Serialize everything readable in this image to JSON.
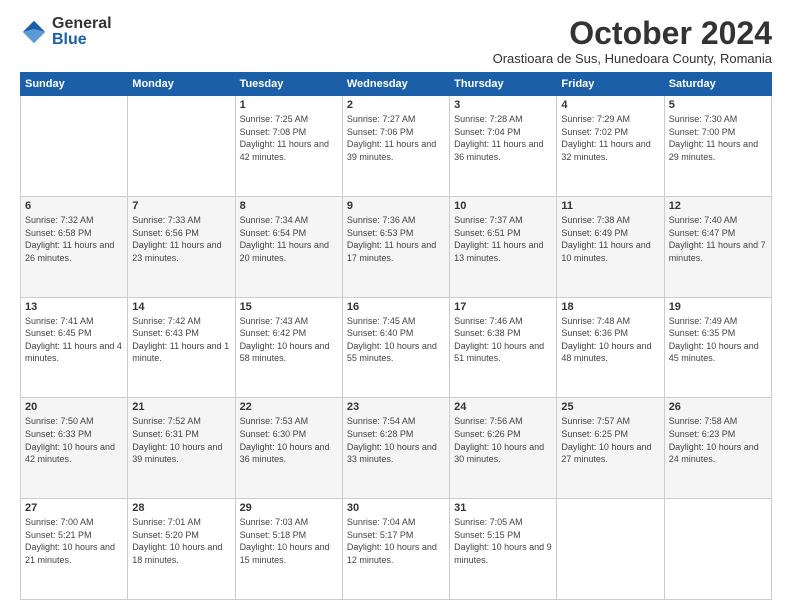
{
  "logo": {
    "general": "General",
    "blue": "Blue"
  },
  "header": {
    "month": "October 2024",
    "location": "Orastioara de Sus, Hunedoara County, Romania"
  },
  "weekdays": [
    "Sunday",
    "Monday",
    "Tuesday",
    "Wednesday",
    "Thursday",
    "Friday",
    "Saturday"
  ],
  "weeks": [
    [
      {
        "day": "",
        "info": ""
      },
      {
        "day": "",
        "info": ""
      },
      {
        "day": "1",
        "info": "Sunrise: 7:25 AM\nSunset: 7:08 PM\nDaylight: 11 hours and 42 minutes."
      },
      {
        "day": "2",
        "info": "Sunrise: 7:27 AM\nSunset: 7:06 PM\nDaylight: 11 hours and 39 minutes."
      },
      {
        "day": "3",
        "info": "Sunrise: 7:28 AM\nSunset: 7:04 PM\nDaylight: 11 hours and 36 minutes."
      },
      {
        "day": "4",
        "info": "Sunrise: 7:29 AM\nSunset: 7:02 PM\nDaylight: 11 hours and 32 minutes."
      },
      {
        "day": "5",
        "info": "Sunrise: 7:30 AM\nSunset: 7:00 PM\nDaylight: 11 hours and 29 minutes."
      }
    ],
    [
      {
        "day": "6",
        "info": "Sunrise: 7:32 AM\nSunset: 6:58 PM\nDaylight: 11 hours and 26 minutes."
      },
      {
        "day": "7",
        "info": "Sunrise: 7:33 AM\nSunset: 6:56 PM\nDaylight: 11 hours and 23 minutes."
      },
      {
        "day": "8",
        "info": "Sunrise: 7:34 AM\nSunset: 6:54 PM\nDaylight: 11 hours and 20 minutes."
      },
      {
        "day": "9",
        "info": "Sunrise: 7:36 AM\nSunset: 6:53 PM\nDaylight: 11 hours and 17 minutes."
      },
      {
        "day": "10",
        "info": "Sunrise: 7:37 AM\nSunset: 6:51 PM\nDaylight: 11 hours and 13 minutes."
      },
      {
        "day": "11",
        "info": "Sunrise: 7:38 AM\nSunset: 6:49 PM\nDaylight: 11 hours and 10 minutes."
      },
      {
        "day": "12",
        "info": "Sunrise: 7:40 AM\nSunset: 6:47 PM\nDaylight: 11 hours and 7 minutes."
      }
    ],
    [
      {
        "day": "13",
        "info": "Sunrise: 7:41 AM\nSunset: 6:45 PM\nDaylight: 11 hours and 4 minutes."
      },
      {
        "day": "14",
        "info": "Sunrise: 7:42 AM\nSunset: 6:43 PM\nDaylight: 11 hours and 1 minute."
      },
      {
        "day": "15",
        "info": "Sunrise: 7:43 AM\nSunset: 6:42 PM\nDaylight: 10 hours and 58 minutes."
      },
      {
        "day": "16",
        "info": "Sunrise: 7:45 AM\nSunset: 6:40 PM\nDaylight: 10 hours and 55 minutes."
      },
      {
        "day": "17",
        "info": "Sunrise: 7:46 AM\nSunset: 6:38 PM\nDaylight: 10 hours and 51 minutes."
      },
      {
        "day": "18",
        "info": "Sunrise: 7:48 AM\nSunset: 6:36 PM\nDaylight: 10 hours and 48 minutes."
      },
      {
        "day": "19",
        "info": "Sunrise: 7:49 AM\nSunset: 6:35 PM\nDaylight: 10 hours and 45 minutes."
      }
    ],
    [
      {
        "day": "20",
        "info": "Sunrise: 7:50 AM\nSunset: 6:33 PM\nDaylight: 10 hours and 42 minutes."
      },
      {
        "day": "21",
        "info": "Sunrise: 7:52 AM\nSunset: 6:31 PM\nDaylight: 10 hours and 39 minutes."
      },
      {
        "day": "22",
        "info": "Sunrise: 7:53 AM\nSunset: 6:30 PM\nDaylight: 10 hours and 36 minutes."
      },
      {
        "day": "23",
        "info": "Sunrise: 7:54 AM\nSunset: 6:28 PM\nDaylight: 10 hours and 33 minutes."
      },
      {
        "day": "24",
        "info": "Sunrise: 7:56 AM\nSunset: 6:26 PM\nDaylight: 10 hours and 30 minutes."
      },
      {
        "day": "25",
        "info": "Sunrise: 7:57 AM\nSunset: 6:25 PM\nDaylight: 10 hours and 27 minutes."
      },
      {
        "day": "26",
        "info": "Sunrise: 7:58 AM\nSunset: 6:23 PM\nDaylight: 10 hours and 24 minutes."
      }
    ],
    [
      {
        "day": "27",
        "info": "Sunrise: 7:00 AM\nSunset: 5:21 PM\nDaylight: 10 hours and 21 minutes."
      },
      {
        "day": "28",
        "info": "Sunrise: 7:01 AM\nSunset: 5:20 PM\nDaylight: 10 hours and 18 minutes."
      },
      {
        "day": "29",
        "info": "Sunrise: 7:03 AM\nSunset: 5:18 PM\nDaylight: 10 hours and 15 minutes."
      },
      {
        "day": "30",
        "info": "Sunrise: 7:04 AM\nSunset: 5:17 PM\nDaylight: 10 hours and 12 minutes."
      },
      {
        "day": "31",
        "info": "Sunrise: 7:05 AM\nSunset: 5:15 PM\nDaylight: 10 hours and 9 minutes."
      },
      {
        "day": "",
        "info": ""
      },
      {
        "day": "",
        "info": ""
      }
    ]
  ]
}
